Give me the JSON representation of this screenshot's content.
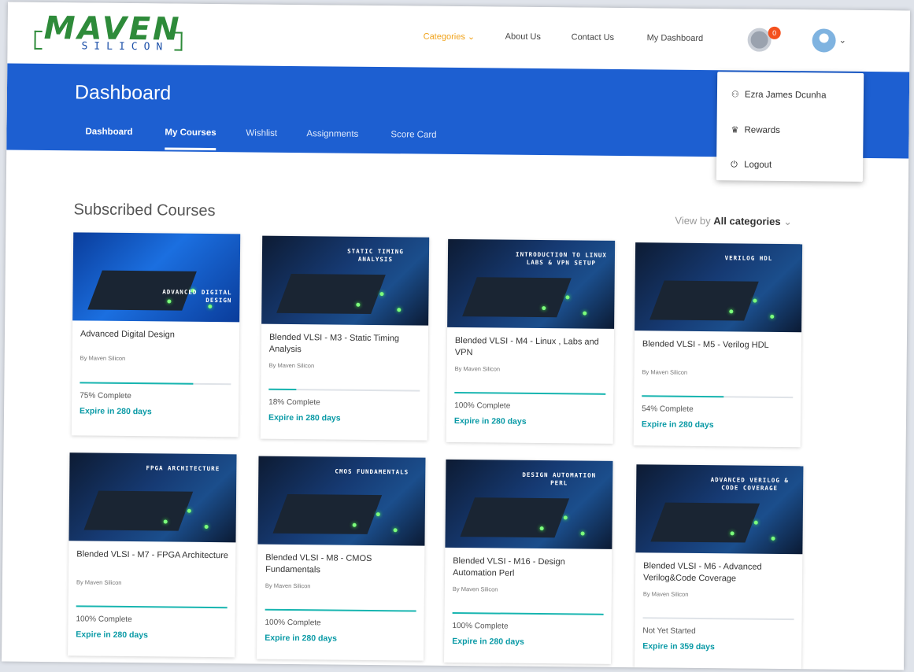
{
  "brand": {
    "name": "MAVEN",
    "subname": "SILICON",
    "color_primary": "#2e8b3a",
    "color_secondary": "#1b4fa8"
  },
  "topnav": {
    "categories": "Categories",
    "about": "About Us",
    "contact": "Contact Us",
    "my_dashboard": "My Dashboard",
    "notification_count": "0"
  },
  "accent_color": "#1d5fd1",
  "band": {
    "title": "Dashboard",
    "tabs": [
      "Dashboard",
      "My Courses",
      "Wishlist",
      "Assignments",
      "Score Card"
    ],
    "active_tab": "My Courses"
  },
  "user_menu": {
    "items": [
      {
        "label": "Ezra James Dcunha",
        "icon": "user-icon"
      },
      {
        "label": "Rewards",
        "icon": "trophy-icon"
      },
      {
        "label": "Logout",
        "icon": "power-icon"
      }
    ]
  },
  "section": {
    "title": "Subscribed Courses",
    "view_by_label": "View by",
    "view_by_value": "All categories"
  },
  "courses": [
    {
      "thumb_text": "ADVANCED DIGITAL DESIGN",
      "title": "Advanced Digital Design",
      "author": "By Maven Silicon",
      "progress": 75,
      "status": "75% Complete",
      "expire": "Expire in 280 days"
    },
    {
      "thumb_text": "STATIC TIMING ANALYSIS",
      "title": "Blended VLSI - M3 - Static Timing Analysis",
      "author": "By Maven Silicon",
      "progress": 18,
      "status": "18% Complete",
      "expire": "Expire in 280 days"
    },
    {
      "thumb_text": "INTRODUCTION TO LINUX LABS & VPN SETUP",
      "title": "Blended VLSI - M4 - Linux , Labs and VPN",
      "author": "By Maven Silicon",
      "progress": 100,
      "status": "100% Complete",
      "expire": "Expire in 280 days"
    },
    {
      "thumb_text": "VERILOG HDL",
      "title": "Blended VLSI - M5 - Verilog HDL",
      "author": "By Maven Silicon",
      "progress": 54,
      "status": "54% Complete",
      "expire": "Expire in 280 days"
    },
    {
      "thumb_text": "FPGA ARCHITECTURE",
      "title": "Blended VLSI - M7 - FPGA Architecture",
      "author": "By Maven Silicon",
      "progress": 100,
      "status": "100% Complete",
      "expire": "Expire in 280 days"
    },
    {
      "thumb_text": "CMOS FUNDAMENTALS",
      "title": "Blended VLSI - M8 - CMOS Fundamentals",
      "author": "By Maven Silicon",
      "progress": 100,
      "status": "100% Complete",
      "expire": "Expire in 280 days"
    },
    {
      "thumb_text": "DESIGN AUTOMATION PERL",
      "title": "Blended VLSI - M16 - Design Automation Perl",
      "author": "By Maven Silicon",
      "progress": 100,
      "status": "100% Complete",
      "expire": "Expire in 280 days"
    },
    {
      "thumb_text": "ADVANCED VERILOG & CODE COVERAGE",
      "title": "Blended VLSI - M6 - Advanced Verilog&Code Coverage",
      "author": "By Maven Silicon",
      "progress": 0,
      "status": "Not Yet Started",
      "expire": "Expire in 359 days"
    }
  ]
}
